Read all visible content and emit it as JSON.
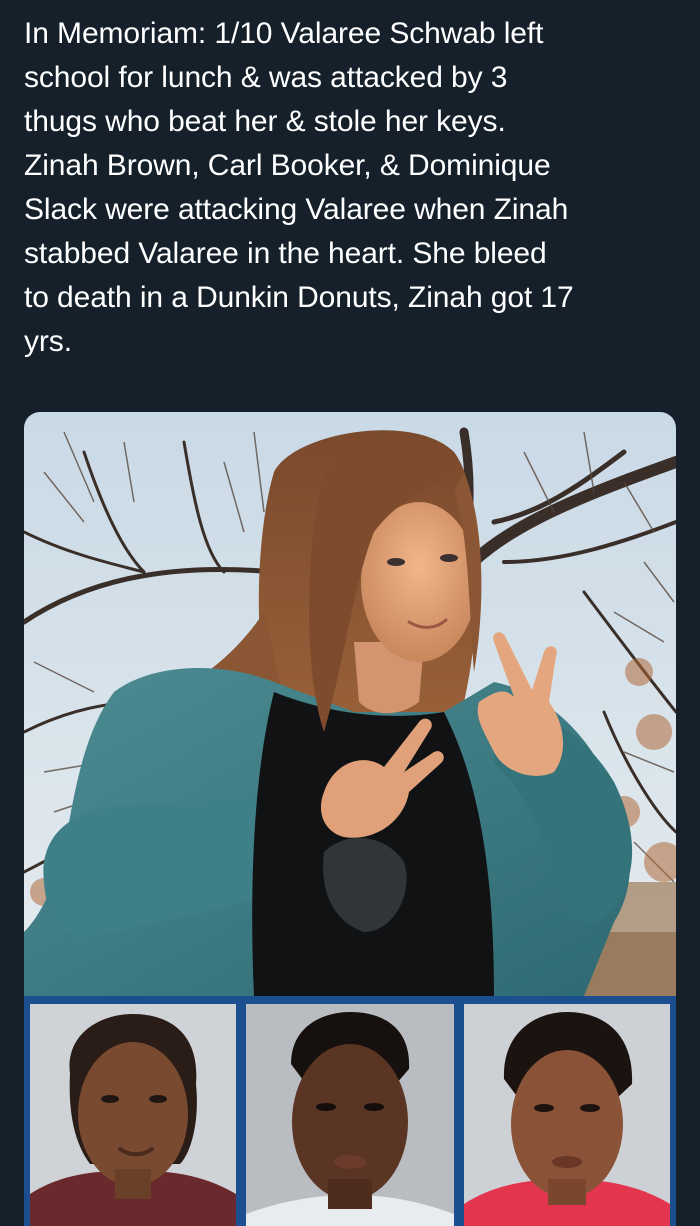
{
  "post": {
    "text": "In Memoriam: 1/10 Valaree Schwab left\nschool for lunch & was attacked by 3\nthugs who beat her & stole her keys.\nZinah Brown, Carl Booker, & Dominique\nSlack were attacking Valaree when Zinah\nstabbed Valaree in the heart. She bleed\nto death in a Dunkin Donuts, Zinah got 17\nyrs."
  },
  "colors": {
    "background": "#15202b",
    "text": "#ffffff",
    "strip_border": "#1b4f8f"
  },
  "media": {
    "main_photo_icon": "portrait-photo",
    "mugshots": [
      {
        "icon": "mugshot-photo-1"
      },
      {
        "icon": "mugshot-photo-2"
      },
      {
        "icon": "mugshot-photo-3"
      }
    ]
  }
}
